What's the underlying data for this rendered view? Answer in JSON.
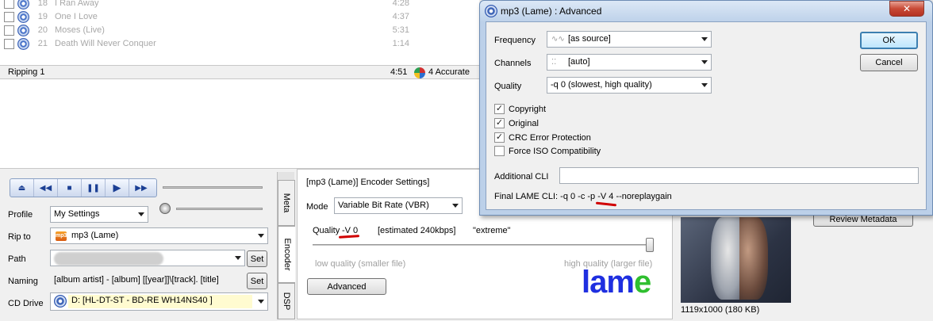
{
  "tracks": [
    {
      "num": "18",
      "title": "I Ran Away",
      "duration": "4:28"
    },
    {
      "num": "19",
      "title": "One I Love",
      "duration": "4:37"
    },
    {
      "num": "20",
      "title": "Moses (Live)",
      "duration": "5:31"
    },
    {
      "num": "21",
      "title": "Death Will Never Conquer",
      "duration": "1:14"
    }
  ],
  "status": {
    "left": "Ripping 1",
    "time": "4:51",
    "accurate": "4 Accurate"
  },
  "form": {
    "profile_label": "Profile",
    "profile_value": "My Settings",
    "ripto_label": "Rip to",
    "ripto_value": "mp3 (Lame)",
    "path_label": "Path",
    "set_label": "Set",
    "naming_label": "Naming",
    "naming_value": "[album artist] - [album] [[year]]\\[track]. [title]",
    "cddrive_label": "CD Drive",
    "cddrive_value": "D:   [HL-DT-ST - BD-RE  WH14NS40 ]"
  },
  "tabs": {
    "meta": "Meta",
    "encoder": "Encoder",
    "dsp": "DSP"
  },
  "encoder": {
    "heading": "[mp3 (Lame)] Encoder Settings]",
    "mode_label": "Mode",
    "mode_value": "Variable Bit Rate (VBR)",
    "quality_label": "Quality",
    "quality_value": "-V 0",
    "estimate": "[estimated 240kbps]",
    "preset": "\"extreme\"",
    "quality_fraction": 1.0,
    "low_label": "low quality (smaller file)",
    "high_label": "high quality (larger file)",
    "advanced_label": "Advanced",
    "logo_letters": [
      "l",
      "a",
      "m",
      "e"
    ],
    "logo_colors": [
      "#1f2fe0",
      "#1f2fe0",
      "#1f2fe0",
      "#2fbf2f"
    ]
  },
  "cover": {
    "caption": "1119x1000  (180 KB)",
    "review_label": "Review Metadata"
  },
  "dialog": {
    "title": "mp3 (Lame) : Advanced",
    "close": "✕",
    "frequency_label": "Frequency",
    "frequency_value": "[as source]",
    "channels_label": "Channels",
    "channels_value": "[auto]",
    "quality_label": "Quality",
    "quality_value": "-q 0 (slowest, high quality)",
    "ok_label": "OK",
    "cancel_label": "Cancel",
    "checkboxes": [
      {
        "label": "Copyright",
        "checked": true
      },
      {
        "label": "Original",
        "checked": true
      },
      {
        "label": "CRC Error Protection",
        "checked": true
      },
      {
        "label": "Force ISO Compatibility",
        "checked": false
      }
    ],
    "additional_cli_label": "Additional CLI",
    "additional_cli_value": "",
    "final_cli_label": "Final LAME CLI:",
    "final_cli_pre": "-q 0 -c -p",
    "final_cli_highlight": "-V 4",
    "final_cli_post": "--noreplaygain"
  },
  "colors": {
    "accent_red": "#d00000",
    "window_frame": "#bcd0e9"
  }
}
